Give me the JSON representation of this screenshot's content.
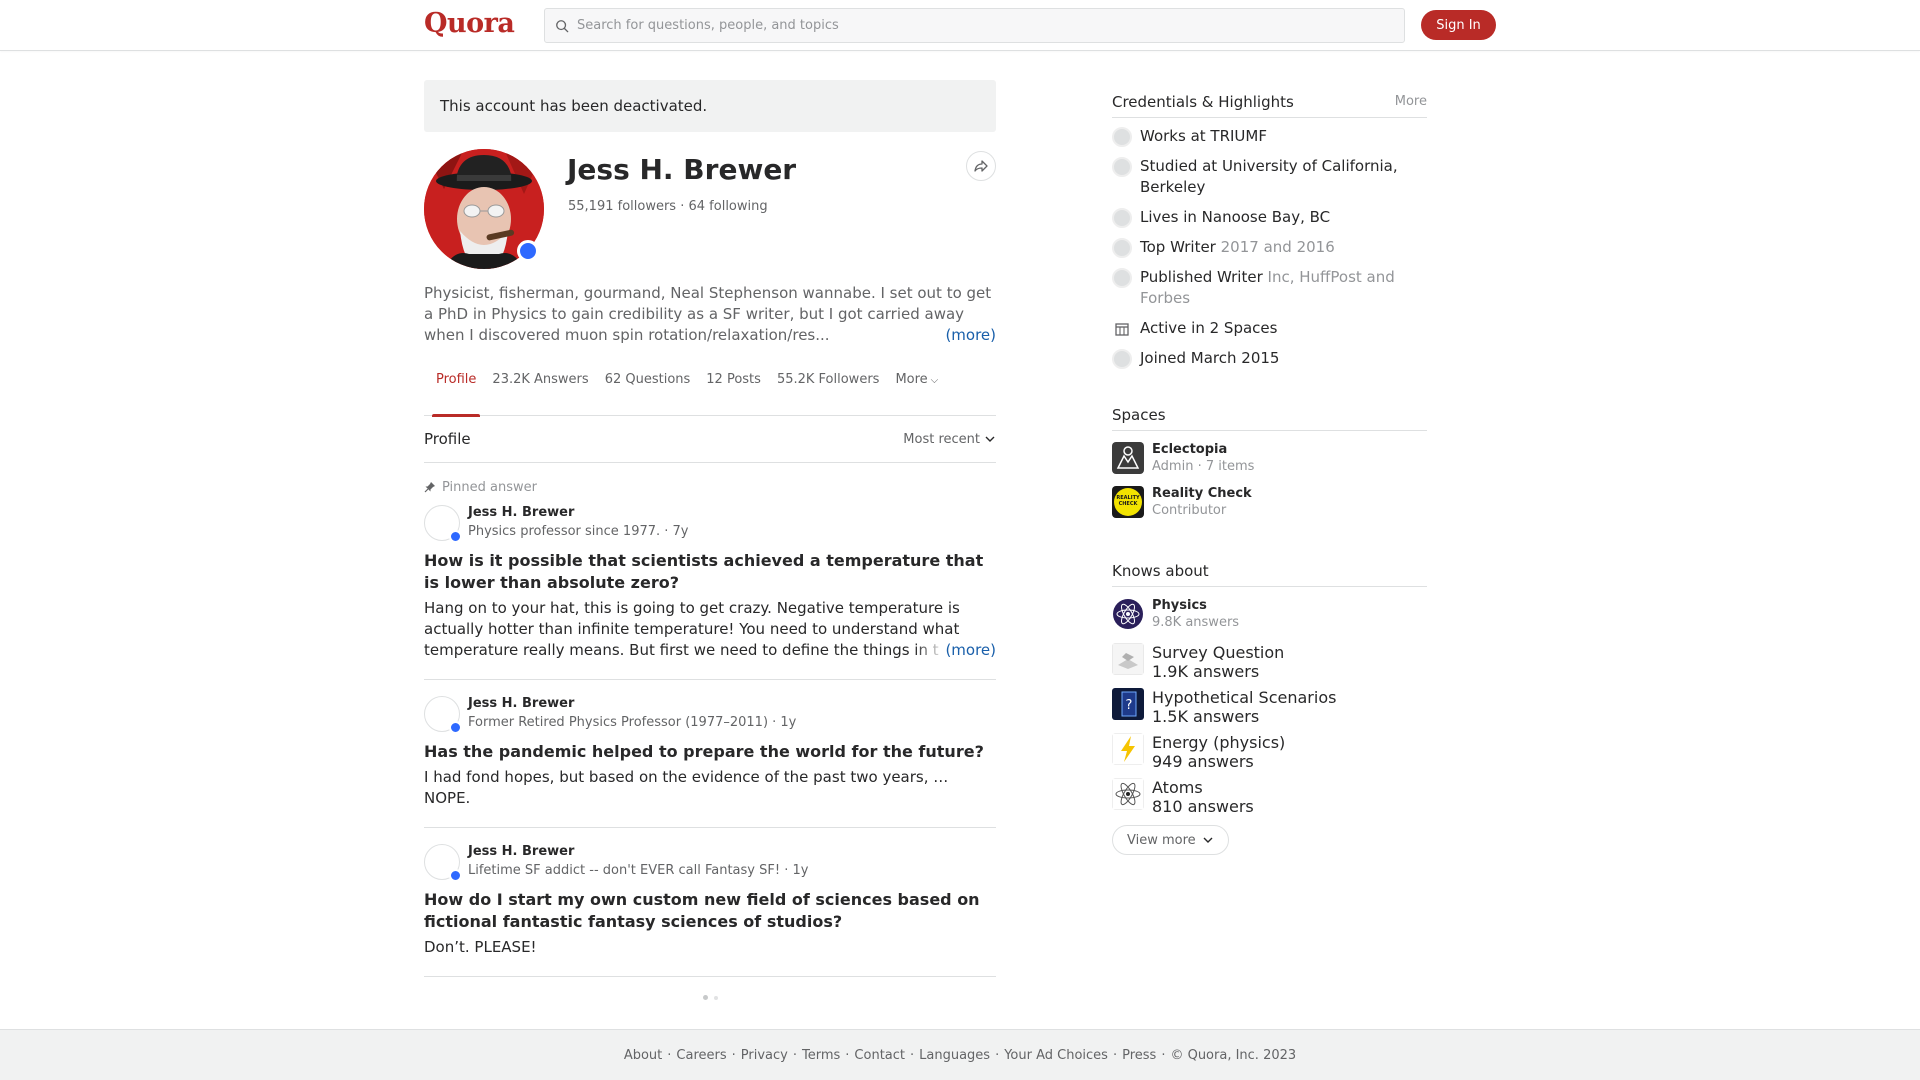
{
  "header": {
    "logo": "Quora",
    "search_placeholder": "Search for questions, people, and topics",
    "signin_label": "Sign In",
    "brand_color": "#b92b27"
  },
  "notice": "This account has been deactivated.",
  "profile": {
    "name": "Jess H. Brewer",
    "followers": "55,191 followers",
    "following": "64 following",
    "stats_sep": "·",
    "bio": "Physicist, fisherman, gourmand, Neal Stephenson wannabe. I set out to get a PhD in Physics to gain credibility as a SF writer, but I got carried away when I discovered muon spin rotation/relaxation/res...",
    "bio_more": "(more)"
  },
  "tabs": [
    {
      "label": "Profile"
    },
    {
      "label": "23.2K Answers"
    },
    {
      "label": "62 Questions"
    },
    {
      "label": "12 Posts"
    },
    {
      "label": "55.2K Followers"
    },
    {
      "label": "More"
    }
  ],
  "feed": {
    "section_title": "Profile",
    "sort_label": "Most recent",
    "pinned_label": "Pinned answer",
    "items": [
      {
        "author": "Jess H. Brewer",
        "credential": "Physics professor since 1977. · 7y",
        "title": "How is it possible that scientists achieved a temperature that is lower than absolute zero?",
        "body": "Hang on to your hat, this is going to get crazy. Negative temperature is actually hotter than infinite temperature! You need to understand what temperature really means. But first we need to define the things in t",
        "more": "(more)"
      },
      {
        "author": "Jess H. Brewer",
        "credential": "Former Retired Physics Professor (1977–2011) · 1y",
        "title": "Has the pandemic helped to prepare the world for the future?",
        "body": "I had fond hopes, but based on the evidence of the past two years, … NOPE."
      },
      {
        "author": "Jess H. Brewer",
        "credential": "Lifetime SF addict -- don't EVER call Fantasy SF! · 1y",
        "title": "How do I start my own custom new field of sciences based on fictional fantastic fantasy sciences of studios?",
        "body": "Don’t. PLEASE!"
      }
    ]
  },
  "sidebar": {
    "credentials_title": "Credentials & Highlights",
    "credentials_more": "More",
    "credentials": [
      {
        "text": "Works at TRIUMF",
        "sub": ""
      },
      {
        "text": "Studied at University of California, Berkeley",
        "sub": ""
      },
      {
        "text": "Lives in Nanoose Bay, BC",
        "sub": ""
      },
      {
        "text": "Top Writer",
        "sub": "2017 and 2016"
      },
      {
        "text": "Published Writer",
        "sub": "Inc, HuffPost and Forbes"
      },
      {
        "text": "Active in 2 Spaces",
        "sub": ""
      },
      {
        "text": "Joined March 2015",
        "sub": ""
      }
    ],
    "spaces_title": "Spaces",
    "spaces": [
      {
        "name": "Eclectopia",
        "role": "Admin · 7 items"
      },
      {
        "name": "Reality Check",
        "role": "Contributor",
        "logo_text": "REALITY CHECK"
      }
    ],
    "knows_title": "Knows about",
    "knows": [
      {
        "name": "Physics",
        "count": "9.8K answers"
      },
      {
        "name": "Survey Question",
        "count": "1.9K answers"
      },
      {
        "name": "Hypothetical Scenarios",
        "count": "1.5K answers"
      },
      {
        "name": "Energy (physics)",
        "count": "949 answers"
      },
      {
        "name": "Atoms",
        "count": "810 answers"
      }
    ],
    "view_more": "View more"
  },
  "footer": {
    "links": [
      "About",
      "Careers",
      "Privacy",
      "Terms",
      "Contact",
      "Languages",
      "Your Ad Choices",
      "Press"
    ],
    "copyright": "© Quora, Inc. 2023",
    "sep": "·"
  }
}
